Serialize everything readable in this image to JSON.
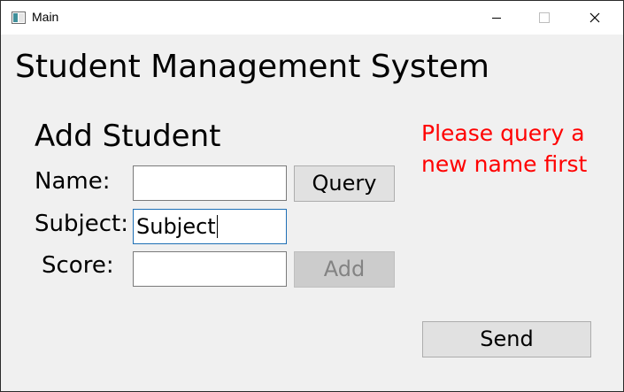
{
  "window": {
    "title": "Main",
    "icon": "app-window-icon",
    "controls": [
      "minimize-icon",
      "maximize-icon",
      "close-icon"
    ]
  },
  "app": {
    "heading": "Student Management System"
  },
  "form": {
    "heading": "Add Student",
    "name_label": "Name:",
    "name_value": "",
    "subject_label": "Subject:",
    "subject_value": "Subject",
    "score_label": "Score:",
    "score_value": "",
    "query_button": "Query",
    "add_button": "Add",
    "add_enabled": false
  },
  "status": {
    "message": "Please query a new name first",
    "color": "#ff0000"
  },
  "send_button": "Send",
  "colors": {
    "background": "#f0f0f0",
    "focus_border": "#1e6fb5",
    "disabled_text": "#838383"
  }
}
